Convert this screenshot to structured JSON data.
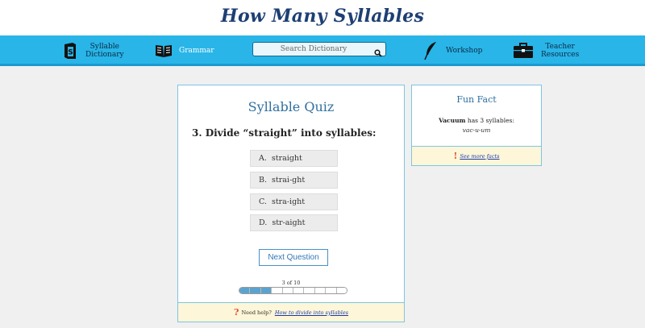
{
  "site": {
    "logo": "How Many Syllables"
  },
  "nav": {
    "syllable_dictionary": [
      "Syllable",
      "Dictionary"
    ],
    "grammar": "Grammar",
    "workshop": "Workshop",
    "teacher_resources": [
      "Teacher",
      "Resources"
    ],
    "search_placeholder": "Search Dictionary"
  },
  "icons": {
    "syllable_dictionary": "dictionary-book-icon",
    "grammar": "open-book-icon",
    "search": "magnifier-icon",
    "workshop": "quill-icon",
    "teacher_resources": "briefcase-icon",
    "help": "question-mark-icon",
    "fact": "exclamation-icon"
  },
  "quiz": {
    "title": "Syllable Quiz",
    "question": "3. Divide “straight” into syllables:",
    "options": [
      {
        "letter": "A.",
        "text": "straight"
      },
      {
        "letter": "B.",
        "text": "strai-ght"
      },
      {
        "letter": "C.",
        "text": "stra-ight"
      },
      {
        "letter": "D.",
        "text": "str-aight"
      }
    ],
    "next_label": "Next Question",
    "progress_text": "3 of 10",
    "progress": {
      "current": 3,
      "total": 10
    },
    "help_text": "Need help?",
    "help_link": "How to divide into syllables",
    "help_icon_glyph": "?"
  },
  "fact": {
    "title": "Fun Fact",
    "word": "Vacuum",
    "text": "has 3 syllables:",
    "syllables": "vac-u-um",
    "link": "See more facts",
    "icon_glyph": "!"
  },
  "colors": {
    "nav_bg": "#29b5e8",
    "accent": "#2f6f9f",
    "progress_fill": "#5aa3cf",
    "footer_bg": "#fdf6d8"
  }
}
